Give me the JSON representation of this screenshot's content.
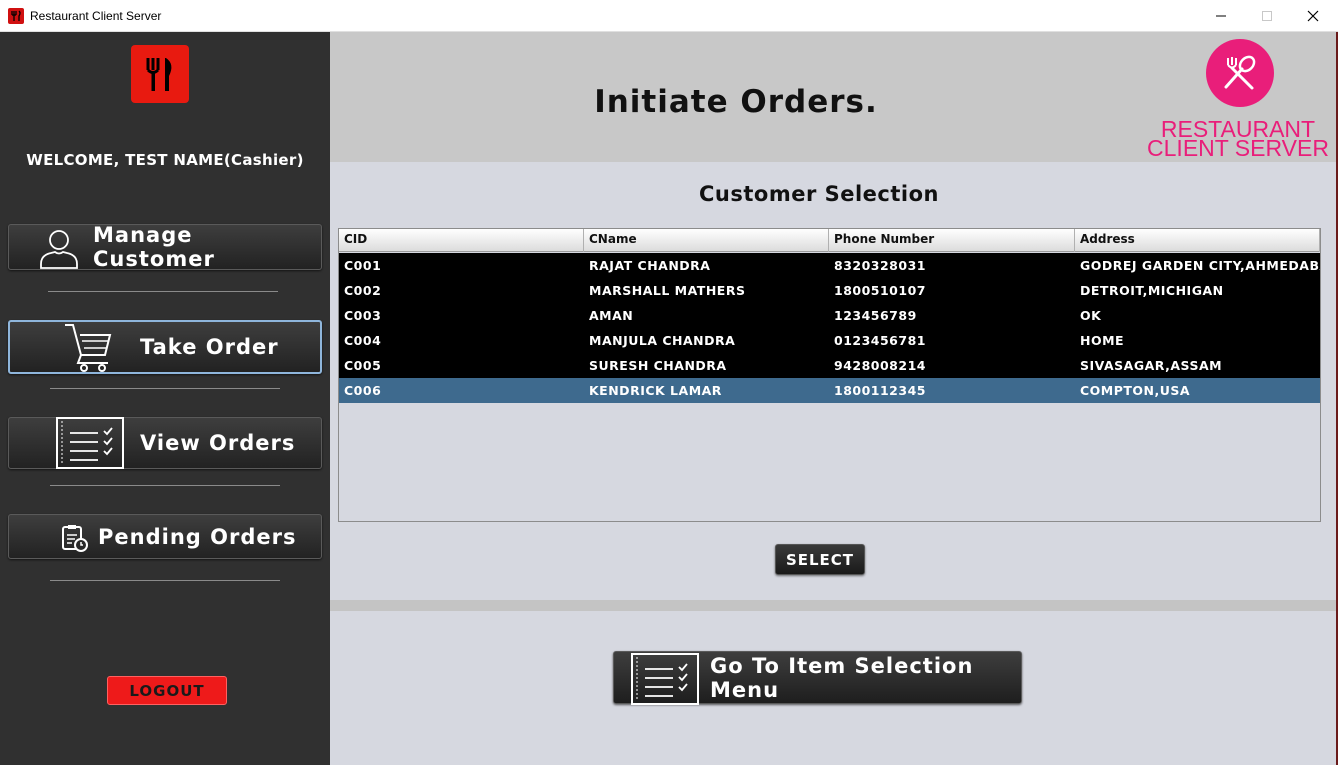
{
  "window": {
    "title": "Restaurant Client Server",
    "controls": [
      "minimize",
      "maximize",
      "close"
    ]
  },
  "sidebar": {
    "welcome": "WELCOME, TEST NAME(Cashier)",
    "buttons": [
      {
        "label": "Manage Customer",
        "icon": "user-icon"
      },
      {
        "label": "Take Order",
        "icon": "cart-icon",
        "active": true
      },
      {
        "label": "View Orders",
        "icon": "checklist-icon"
      },
      {
        "label": "Pending Orders",
        "icon": "clipboard-clock-icon"
      }
    ],
    "logout_label": "LOGOUT"
  },
  "header": {
    "title": "Initiate Orders.",
    "brand_line1": "RESTAURANT",
    "brand_line2": "CLIENT SERVER"
  },
  "customer_selection": {
    "title": "Customer Selection",
    "columns": [
      "CID",
      "CName",
      "Phone Number",
      "Address"
    ],
    "rows": [
      [
        "C001",
        "RAJAT CHANDRA",
        "8320328031",
        "GODREJ GARDEN CITY,AHMEDABA..."
      ],
      [
        "C002",
        "MARSHALL MATHERS",
        "1800510107",
        "DETROIT,MICHIGAN"
      ],
      [
        "C003",
        "AMAN",
        "123456789",
        "OK"
      ],
      [
        "C004",
        "MANJULA CHANDRA",
        "0123456781",
        "HOME"
      ],
      [
        "C005",
        "SURESH CHANDRA",
        "9428008214",
        "SIVASAGAR,ASSAM"
      ],
      [
        "C006",
        "KENDRICK LAMAR",
        "1800112345",
        "COMPTON,USA"
      ]
    ],
    "selected_row": 5,
    "select_label": "SELECT"
  },
  "footer": {
    "goto_label": "Go To Item Selection Menu"
  },
  "colors": {
    "sidebar_bg": "#303030",
    "main_bg": "#d6d8e0",
    "header_bg": "#c8c8c8",
    "brand_pink": "#e91e7a",
    "logout_red": "#ee1a1a",
    "selected_row": "#3e6a8e",
    "logo_red": "#e81a10"
  }
}
